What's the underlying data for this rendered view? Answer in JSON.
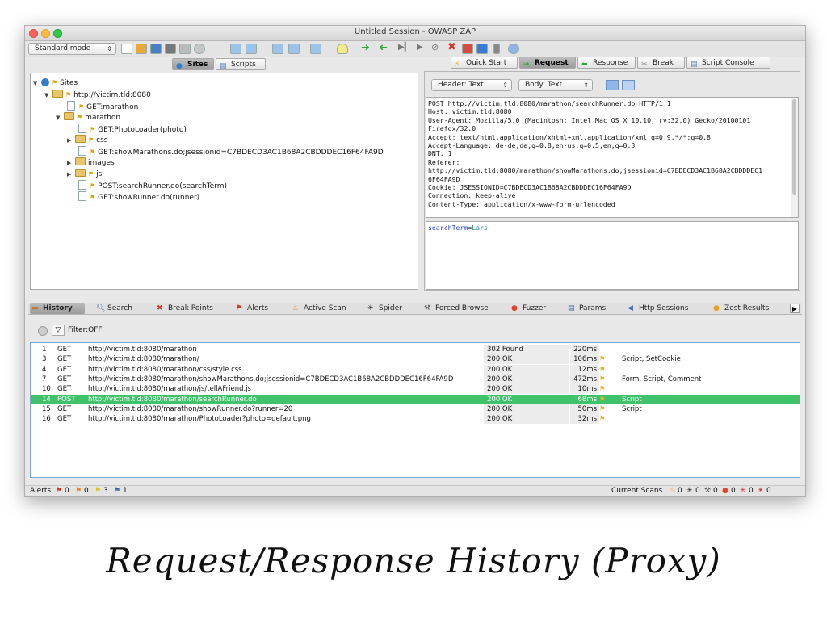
{
  "window": {
    "title": "Untitled Session - OWASP ZAP"
  },
  "toolbar": {
    "mode": "Standard mode"
  },
  "left_tabs": [
    {
      "label": "Sites",
      "icon": "globe-icon"
    },
    {
      "label": "Scripts",
      "icon": "script-icon"
    }
  ],
  "right_tabs": [
    {
      "label": "Quick Start",
      "icon": "lightning-icon"
    },
    {
      "label": "Request",
      "icon": "arrow-right-icon"
    },
    {
      "label": "Response",
      "icon": "arrow-left-icon"
    },
    {
      "label": "Break",
      "icon": "break-icon"
    },
    {
      "label": "Script Console",
      "icon": "script-icon"
    }
  ],
  "tree": {
    "root": "Sites",
    "host": "http://victim.tld:8080",
    "n1": "GET:marathon",
    "n2": "marathon",
    "n3": "GET:PhotoLoader(photo)",
    "n4": "css",
    "n5": "GET:showMarathons.do;jsessionid=C7BDECD3AC1B68A2CBDDDEC16F64FA9D",
    "n6": "images",
    "n7": "js",
    "n8": "POST:searchRunner.do(searchTerm)",
    "n9": "GET:showRunner.do(runner)"
  },
  "request": {
    "header_view": "Header: Text",
    "body_view": "Body: Text",
    "header_lines": [
      "POST http://victim.tld:8080/marathon/searchRunner.do HTTP/1.1",
      "Host: victim.tld:8080",
      "User-Agent: Mozilla/5.0 (Macintosh; Intel Mac OS X 10.10; rv:32.0) Gecko/20100101",
      "Firefox/32.0",
      "Accept: text/html,application/xhtml+xml,application/xml;q=0.9,*/*;q=0.8",
      "Accept-Language: de-de,de;q=0.8,en-us;q=0.5,en;q=0.3",
      "DNT: 1",
      "Referer:",
      "http://victim.tld:8080/marathon/showMarathons.do;jsessionid=C7BDECD3AC1B68A2CBDDDEC1",
      "6F64FA9D",
      "Cookie: JSESSIONID=C7BDECD3AC1B68A2CBDDDEC16F64FA9D",
      "Connection: keep-alive",
      "Content-Type: application/x-www-form-urlencoded"
    ],
    "body_key": "searchTerm",
    "body_eq": "=",
    "body_val": "Lars"
  },
  "bottom_tabs": [
    {
      "label": "History",
      "icon": "history-icon"
    },
    {
      "label": "Search",
      "icon": "search-icon"
    },
    {
      "label": "Break Points",
      "icon": "breakpoint-icon"
    },
    {
      "label": "Alerts",
      "icon": "flag-icon"
    },
    {
      "label": "Active Scan",
      "icon": "fire-icon"
    },
    {
      "label": "Spider",
      "icon": "spider-icon"
    },
    {
      "label": "Forced Browse",
      "icon": "hammer-icon"
    },
    {
      "label": "Fuzzer",
      "icon": "fuzzer-icon"
    },
    {
      "label": "Params",
      "icon": "params-icon"
    },
    {
      "label": "Http Sessions",
      "icon": "sessions-icon"
    },
    {
      "label": "Zest Results",
      "icon": "zest-icon"
    }
  ],
  "filter": {
    "label": "Filter:OFF"
  },
  "history": [
    {
      "id": "1",
      "method": "GET",
      "url": "http://victim.tld:8080/marathon",
      "code": "302 Found",
      "rtt": "220ms",
      "flag": false,
      "tags": ""
    },
    {
      "id": "3",
      "method": "GET",
      "url": "http://victim.tld:8080/marathon/",
      "code": "200 OK",
      "rtt": "106ms",
      "flag": true,
      "tags": "Script, SetCookie"
    },
    {
      "id": "4",
      "method": "GET",
      "url": "http://victim.tld:8080/marathon/css/style.css",
      "code": "200 OK",
      "rtt": "12ms",
      "flag": true,
      "tags": ""
    },
    {
      "id": "7",
      "method": "GET",
      "url": "http://victim.tld:8080/marathon/showMarathons.do;jsessionid=C7BDECD3AC1B68A2CBDDDEC16F64FA9D",
      "code": "200 OK",
      "rtt": "472ms",
      "flag": true,
      "tags": "Form, Script, Comment"
    },
    {
      "id": "10",
      "method": "GET",
      "url": "http://victim.tld:8080/marathon/js/tellAFriend.js",
      "code": "200 OK",
      "rtt": "10ms",
      "flag": true,
      "tags": ""
    },
    {
      "id": "14",
      "method": "POST",
      "url": "http://victim.tld:8080/marathon/searchRunner.do",
      "code": "200 OK",
      "rtt": "68ms",
      "flag": true,
      "tags": "Script"
    },
    {
      "id": "15",
      "method": "GET",
      "url": "http://victim.tld:8080/marathon/showRunner.do?runner=20",
      "code": "200 OK",
      "rtt": "50ms",
      "flag": true,
      "tags": "Script"
    },
    {
      "id": "16",
      "method": "GET",
      "url": "http://victim.tld:8080/marathon/PhotoLoader?photo=default.png",
      "code": "200 OK",
      "rtt": "32ms",
      "flag": true,
      "tags": ""
    }
  ],
  "status": {
    "alerts_label": "Alerts",
    "alerts": [
      "0",
      "0",
      "3",
      "1"
    ],
    "scans_label": "Current Scans",
    "scans": [
      "0",
      "0",
      "0",
      "0",
      "0",
      "0"
    ]
  },
  "caption": "Request/Response History (Proxy)",
  "colors": {
    "selected_row": "#3fc26a",
    "accent_blue": "#2f7fc9"
  }
}
